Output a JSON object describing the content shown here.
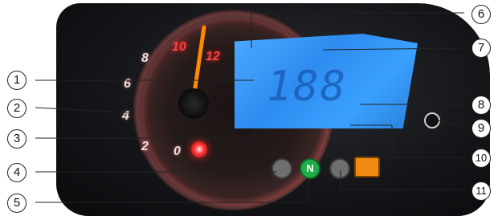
{
  "tachometer": {
    "numbers": [
      "0",
      "2",
      "4",
      "6",
      "8",
      "10",
      "12"
    ]
  },
  "lcd": {
    "speed": "188"
  },
  "indicators": {
    "neutral": "N"
  },
  "callouts": [
    "1",
    "2",
    "3",
    "4",
    "5",
    "6",
    "7",
    "8",
    "9",
    "10",
    "11"
  ]
}
